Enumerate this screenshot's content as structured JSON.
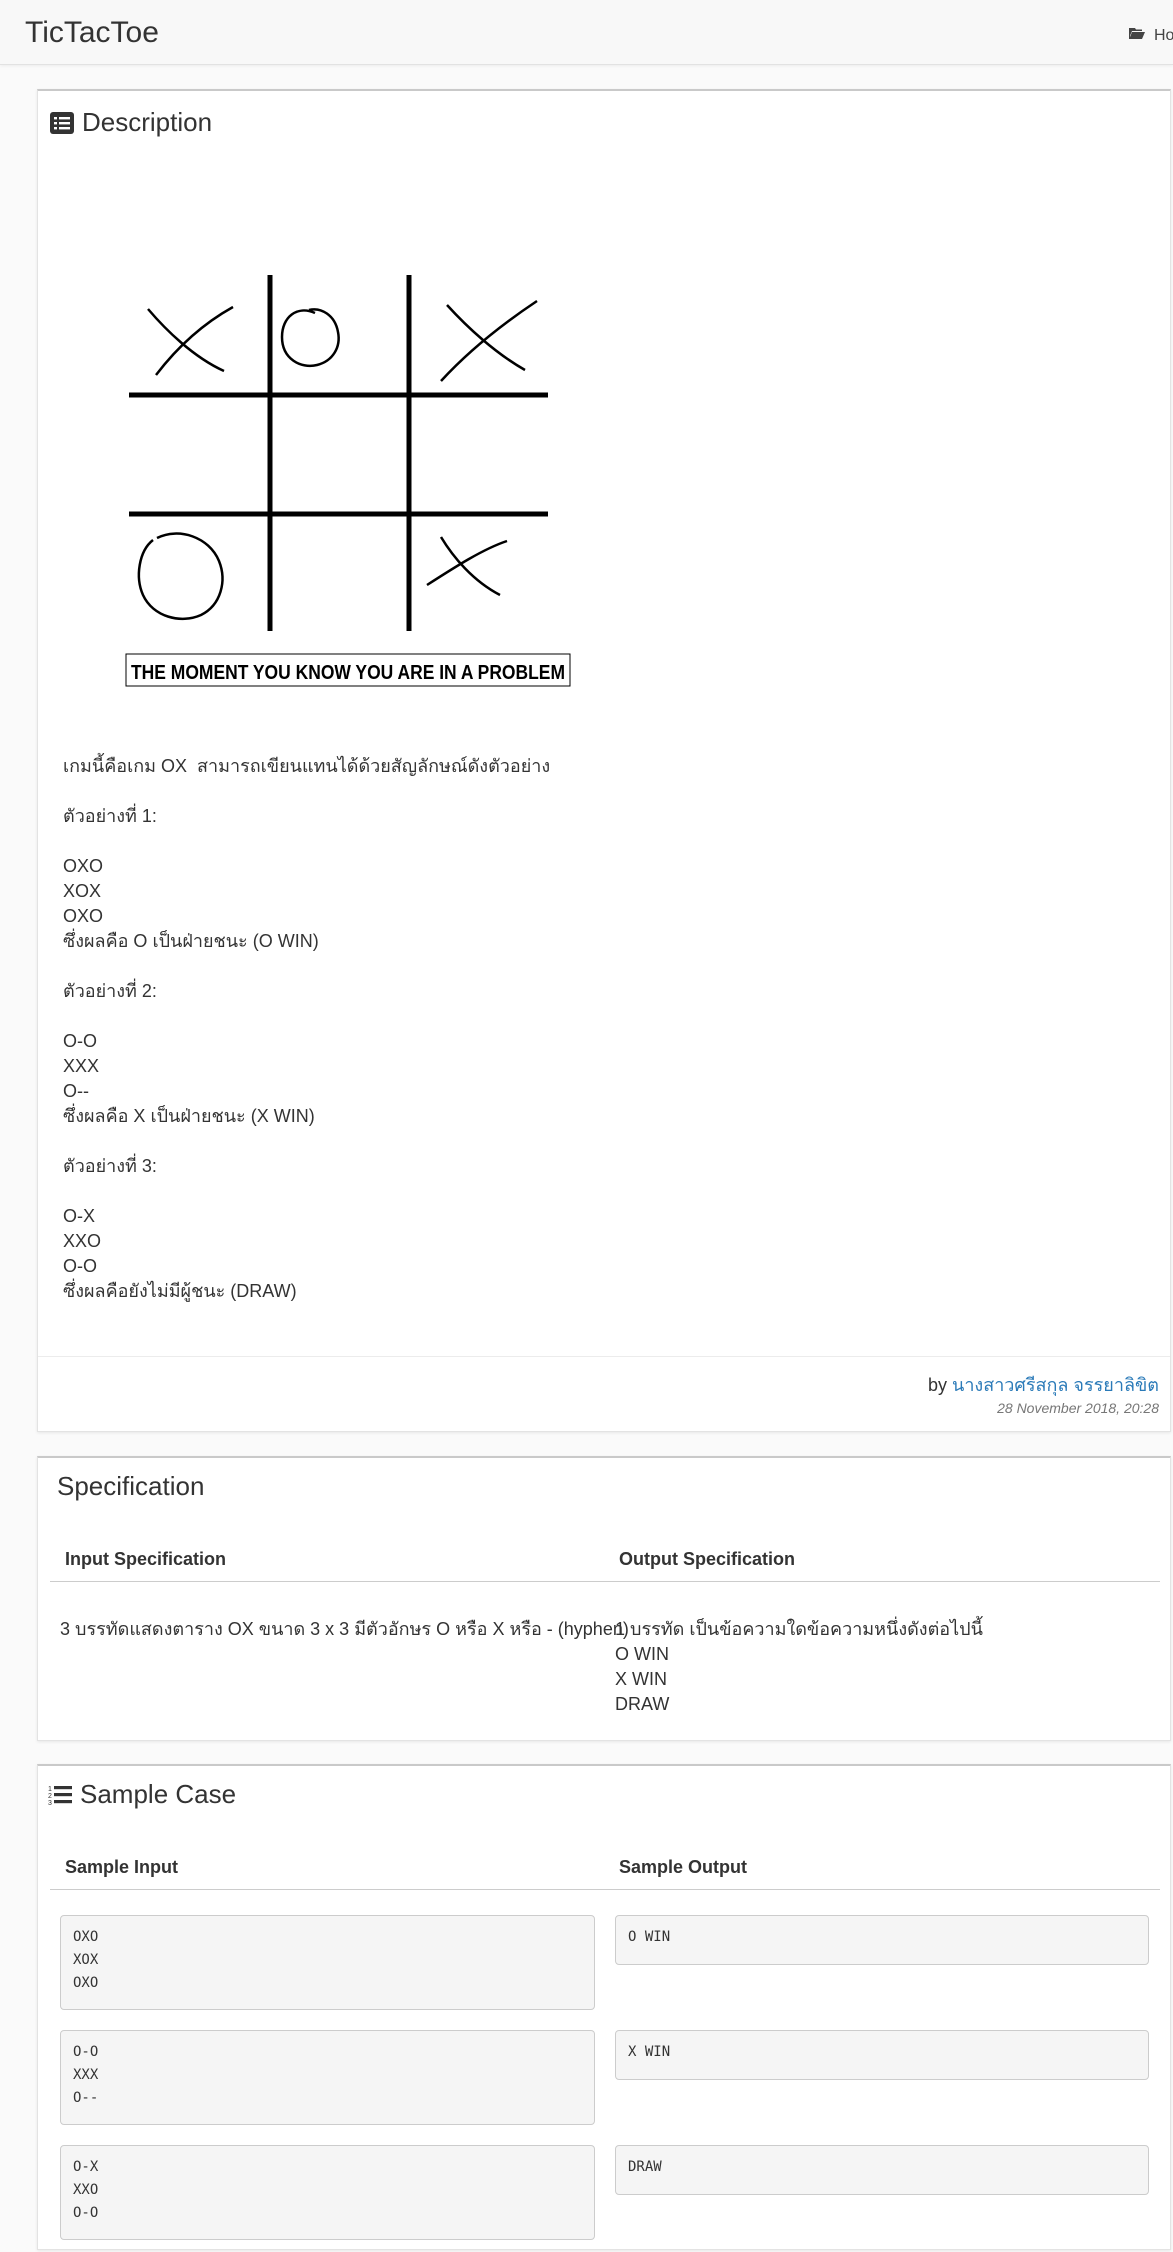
{
  "navbar": {
    "brand": "TicTacToe",
    "nav_home": "Ho",
    "nav_icon": "folder-open-icon"
  },
  "description": {
    "title": "Description",
    "title_icon": "list-alt-icon",
    "image_caption": "THE MOMENT YOU KNOW YOU ARE IN A PROBLEM",
    "lines": [
      "เกมนี้คือเกม OX  สามารถเขียนแทนได้ด้วยสัญลักษณ์ดังตัวอย่าง",
      "",
      "ตัวอย่างที่ 1:",
      "",
      "OXO",
      "XOX",
      "OXO",
      "ซึ่งผลคือ O เป็นฝ่ายชนะ (O WIN)",
      "",
      "ตัวอย่างที่ 2:",
      "",
      "O-O",
      "XXX",
      "O--",
      "ซึ่งผลคือ X เป็นฝ่ายชนะ (X WIN)",
      "",
      "ตัวอย่างที่ 3:",
      "",
      "O-X",
      "XXO",
      "O-O",
      "ซึ่งผลคือยังไม่มีผู้ชนะ (DRAW)"
    ],
    "by_prefix": "by",
    "author": "นางสาวศรีสกุล จรรยาลิขิต",
    "date": "28 November 2018, 20:28"
  },
  "specification": {
    "title": "Specification",
    "input_header": "Input Specification",
    "output_header": "Output Specification",
    "input_text": "3 บรรทัดแสดงตาราง OX ขนาด 3 x 3 มีตัวอักษร O หรือ X หรือ - (hyphen)",
    "output_lines": [
      "1 บรรทัด เป็นข้อความใดข้อความหนึ่งดังต่อไปนี้",
      "O WIN",
      "X WIN",
      "DRAW"
    ]
  },
  "sample": {
    "title": "Sample Case",
    "title_icon": "list-ol-icon",
    "input_header": "Sample Input",
    "output_header": "Sample Output",
    "cases": [
      {
        "input": [
          "OXO",
          "XOX",
          "OXO"
        ],
        "output": "O WIN"
      },
      {
        "input": [
          "O-O",
          "XXX",
          "O--"
        ],
        "output": "X WIN"
      },
      {
        "input": [
          "O-X",
          "XXO",
          "O-O"
        ],
        "output": "DRAW"
      }
    ]
  },
  "colors": {
    "link": "#2a7ab8",
    "code_bg": "#f5f5f5",
    "page_bg": "#fafafa"
  }
}
